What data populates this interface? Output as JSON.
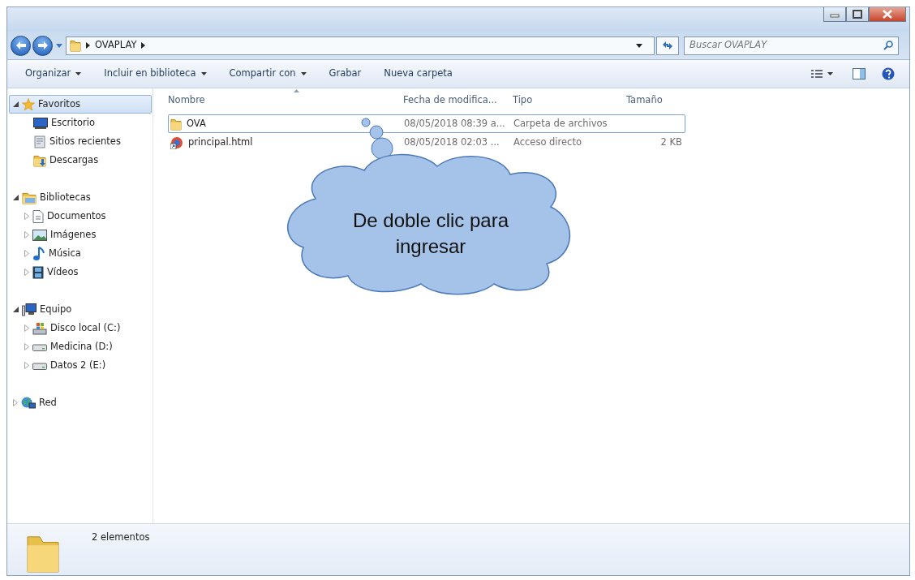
{
  "address_bar": {
    "segments": [
      "OVAPLAY"
    ]
  },
  "search": {
    "placeholder": "Buscar OVAPLAY"
  },
  "toolbar": [
    {
      "label": "Organizar",
      "dropdown": true
    },
    {
      "label": "Incluir en biblioteca",
      "dropdown": true
    },
    {
      "label": "Compartir con",
      "dropdown": true
    },
    {
      "label": "Grabar",
      "dropdown": false
    },
    {
      "label": "Nueva carpeta",
      "dropdown": false
    }
  ],
  "sidebar": {
    "items": [
      {
        "label": "Favoritos",
        "kind": "star",
        "expanded": true,
        "selected": true,
        "children": [
          {
            "label": "Escritorio",
            "kind": "desktop",
            "selected": false
          },
          {
            "label": "Sitios recientes",
            "kind": "recent",
            "selected": false
          },
          {
            "label": "Descargas",
            "kind": "download",
            "selected": false
          }
        ]
      },
      {
        "label": "Bibliotecas",
        "kind": "library",
        "expanded": true,
        "selected": false,
        "children": [
          {
            "label": "Documentos",
            "kind": "document",
            "expanded": false,
            "selected": false
          },
          {
            "label": "Imágenes",
            "kind": "image",
            "expanded": false,
            "selected": false
          },
          {
            "label": "Música",
            "kind": "music",
            "expanded": false,
            "selected": false
          },
          {
            "label": "Vídeos",
            "kind": "video",
            "expanded": false,
            "selected": false
          }
        ]
      },
      {
        "label": "Equipo",
        "kind": "computer",
        "expanded": true,
        "selected": false,
        "children": [
          {
            "label": "Disco local (C:)",
            "kind": "system-drive",
            "expanded": false,
            "selected": false
          },
          {
            "label": "Medicina (D:)",
            "kind": "drive",
            "expanded": false,
            "selected": false
          },
          {
            "label": "Datos 2 (E:)",
            "kind": "drive",
            "expanded": false,
            "selected": false
          }
        ]
      },
      {
        "label": "Red",
        "kind": "network",
        "expanded": false,
        "selected": false
      }
    ]
  },
  "table": {
    "columns": [
      "Nombre",
      "Fecha de modifica...",
      "Tipo",
      "Tamaño"
    ],
    "rows": [
      {
        "name": "OVA",
        "kind": "folder",
        "date": "08/05/2018 08:39 a...",
        "type": "Carpeta de archivos",
        "selected": true
      },
      {
        "name": "principal.html",
        "kind": "shortcut",
        "date": "08/05/2018 02:03 ...",
        "type": "Acceso directo",
        "size": "2 KB",
        "selected": false
      }
    ]
  },
  "callout": {
    "text": "De doble clic para ingresar"
  },
  "status_bar": {
    "text": "2 elementos"
  }
}
